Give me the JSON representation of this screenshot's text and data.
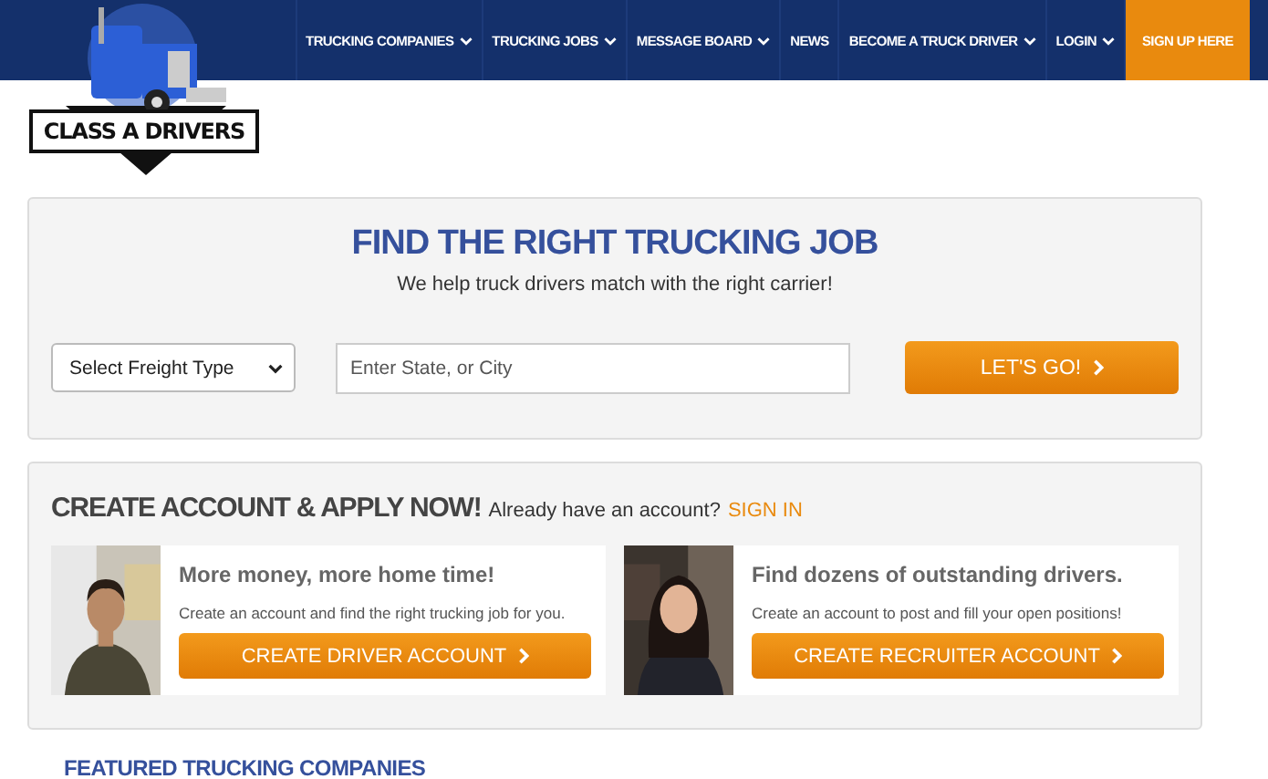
{
  "logo": {
    "text": "CLASS A DRIVERS"
  },
  "nav": [
    {
      "label": "TRUCKING COMPANIES",
      "dropdown": true,
      "kind": "link"
    },
    {
      "label": "TRUCKING JOBS",
      "dropdown": true,
      "kind": "link"
    },
    {
      "label": "MESSAGE BOARD",
      "dropdown": true,
      "kind": "link"
    },
    {
      "label": "NEWS",
      "dropdown": false,
      "kind": "link"
    },
    {
      "label": "BECOME A TRUCK DRIVER",
      "dropdown": true,
      "kind": "link"
    },
    {
      "label": "LOGIN",
      "dropdown": true,
      "kind": "link"
    },
    {
      "label": "SIGN UP HERE",
      "dropdown": false,
      "kind": "cta"
    }
  ],
  "search": {
    "title": "FIND THE RIGHT TRUCKING JOB",
    "subtitle": "We help truck drivers match with the right carrier!",
    "freight_select": "Select Freight Type",
    "location": {
      "placeholder": "Enter State, or City"
    },
    "button": "LET'S GO!"
  },
  "signup": {
    "title": "CREATE ACCOUNT & APPLY NOW!",
    "prompt": "Already have an account?",
    "link": "SIGN IN",
    "cards": [
      {
        "heading": "More money, more home time!",
        "text": "Create an account and find the right trucking job for you.",
        "button": "CREATE DRIVER ACCOUNT"
      },
      {
        "heading": "Find dozens of outstanding drivers.",
        "text": "Create an account to post and fill your open positions!",
        "button": "CREATE RECRUITER ACCOUNT"
      }
    ]
  },
  "featured": {
    "title": "FEATURED TRUCKING COMPANIES"
  }
}
